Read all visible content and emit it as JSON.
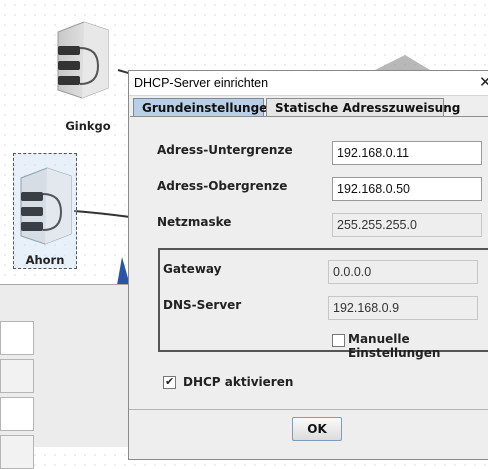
{
  "canvas": {
    "nodes": [
      {
        "label": "Ginkgo",
        "icon": "server-icon",
        "selected": false
      },
      {
        "label": "Ahorn",
        "icon": "server-icon",
        "selected": true
      }
    ]
  },
  "dialog": {
    "title": "DHCP-Server einrichten",
    "close_icon": "close-icon",
    "tabs": [
      {
        "label": "Grundeinstellungen",
        "active": true
      },
      {
        "label": "Statische Adresszuweisung",
        "active": false
      }
    ],
    "fields": {
      "lower_bound": {
        "label": "Adress-Untergrenze",
        "value": "192.168.0.11"
      },
      "upper_bound": {
        "label": "Adress-Obergrenze",
        "value": "192.168.0.50"
      },
      "netmask": {
        "label": "Netzmaske",
        "value": "255.255.255.0"
      }
    },
    "group": {
      "gateway": {
        "label": "Gateway",
        "value": "0.0.0.0"
      },
      "dns": {
        "label": "DNS-Server",
        "value": "192.168.0.9"
      },
      "manual_checkbox": {
        "label": "Manuelle Einstellungen",
        "checked": false
      }
    },
    "dhcp_checkbox": {
      "label": "DHCP aktivieren",
      "checked": true
    },
    "ok_label": "OK"
  },
  "colors": {
    "active_tab": "#b8cfe5",
    "selection_fill": "#dbe8f5"
  }
}
